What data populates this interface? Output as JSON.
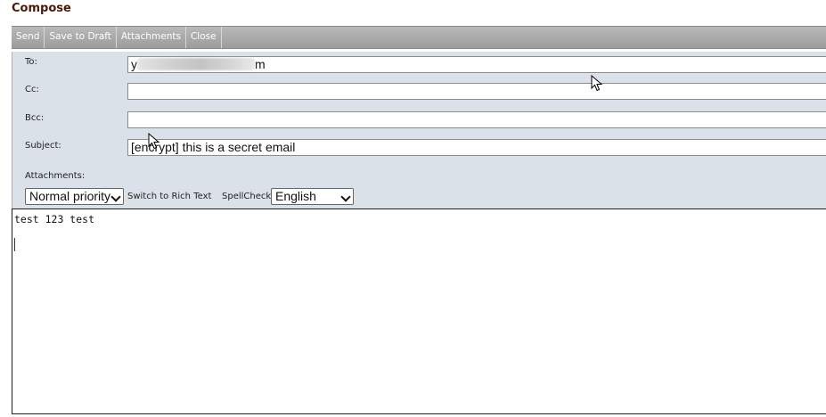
{
  "window": {
    "title": "Compose"
  },
  "toolbar": {
    "send": "Send",
    "save_draft": "Save to Draft",
    "attachments": "Attachments",
    "close": "Close"
  },
  "fields": {
    "to": {
      "label": "To:",
      "value_start": "y",
      "value_end": "m"
    },
    "cc": {
      "label": "Cc:",
      "value": ""
    },
    "bcc": {
      "label": "Bcc:",
      "value": ""
    },
    "subject": {
      "label": "Subject:",
      "value": "[encrypt] this is a secret email"
    },
    "attachments_label": "Attachments:"
  },
  "options": {
    "priority": "Normal priority",
    "rich_text_link": "Switch to Rich Text",
    "spellcheck_label": "SpellCheck",
    "spellcheck_language": "English"
  },
  "message": {
    "body": "test 123 test"
  }
}
